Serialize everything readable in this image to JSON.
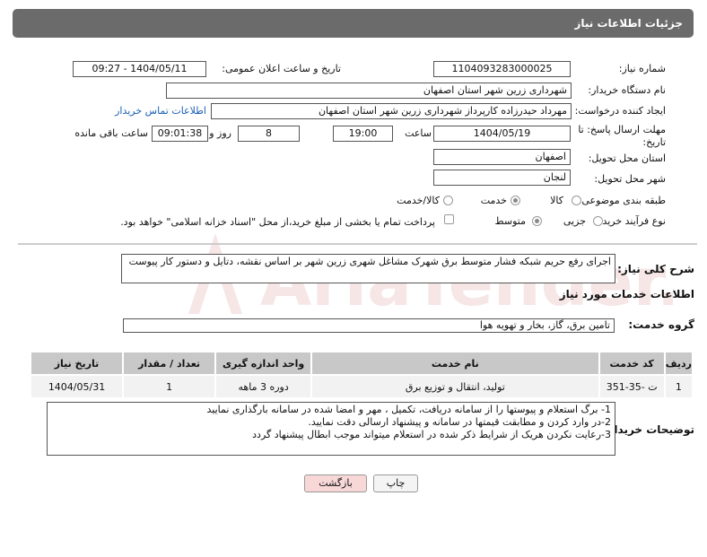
{
  "header": {
    "title": "جزئیات اطلاعات نیاز"
  },
  "fields": {
    "need_number_label": "شماره نیاز:",
    "need_number": "1104093283000025",
    "announce_label": "تاریخ و ساعت اعلان عمومی:",
    "announce_value": "1404/05/11 - 09:27",
    "buyer_org_label": "نام دستگاه خریدار:",
    "buyer_org": "شهرداری زرین شهر استان اصفهان",
    "creator_label": "ایجاد کننده درخواست:",
    "creator": "مهرداد حیدرزاده کارپرداز شهرداری زرین شهر استان اصفهان",
    "contact_link": "اطلاعات تماس خریدار",
    "deadline_label_1": "مهلت ارسال پاسخ: تا",
    "deadline_label_2": "تاریخ:",
    "deadline_date": "1404/05/19",
    "time_label": "ساعت",
    "deadline_time": "19:00",
    "days_value": "8",
    "days_label": "روز و",
    "remaining_time": "09:01:38",
    "remaining_label": "ساعت باقی مانده",
    "province_label": "استان محل تحویل:",
    "province": "اصفهان",
    "city_label": "شهر محل تحویل:",
    "city": "لنجان",
    "category_label": "طبقه بندی موضوعی:",
    "category_options": [
      "کالا",
      "خدمت",
      "کالا/خدمت"
    ],
    "category_selected": "خدمت",
    "process_label": "نوع فرآیند خرید :",
    "process_options": [
      "جزیی",
      "متوسط"
    ],
    "process_selected": "متوسط",
    "payment_note": "پرداخت تمام یا بخشی از مبلغ خرید،از محل \"اسناد خزانه اسلامی\" خواهد بود."
  },
  "description": {
    "label": "شرح کلی نیاز:",
    "text": "اجرای رفع حریم شبکه فشار متوسط برق شهرک مشاغل شهری زرین شهر بر اساس نقشه، دتایل و دستور کار پیوست"
  },
  "services": {
    "section_title": "اطلاعات خدمات مورد نیاز",
    "group_label": "گروه خدمت:",
    "group_value": "تامین برق، گاز، بخار و تهویه هوا",
    "columns": [
      "ردیف",
      "کد خدمت",
      "نام خدمت",
      "واحد اندازه گیری",
      "تعداد / مقدار",
      "تاریخ نیاز"
    ],
    "rows": [
      {
        "index": "1",
        "code": "ت -35-351",
        "name": "تولید، انتقال و توزیع برق",
        "unit": "دوره 3 ماهه",
        "qty": "1",
        "date": "1404/05/31"
      }
    ]
  },
  "buyer_notes": {
    "label": "توضیحات خریدار:",
    "lines": [
      "1- برگ استعلام و پیوستها را از سامانه دریافت، تکمیل ، مهر و امضا شده در سامانه بارگذاری نمایید",
      "2-در وارد کردن و مطابقت قیمتها در سامانه و پیشنهاد ارسالی دقت نمایید.",
      "3-رعایت نکردن هریک از شرایط  ذکر شده در استعلام میتواند موجب ابطال پیشنهاد گردد"
    ]
  },
  "buttons": {
    "print": "چاپ",
    "back": "بازگشت"
  },
  "colors": {
    "header_bg": "#6b6b6b",
    "table_header_bg": "#c8c8c8",
    "back_button_bg": "#f8d7d7",
    "link": "#1a5fb4",
    "watermark": "#e6b8b8"
  },
  "watermark": {
    "text": "AriaTender.neT"
  }
}
